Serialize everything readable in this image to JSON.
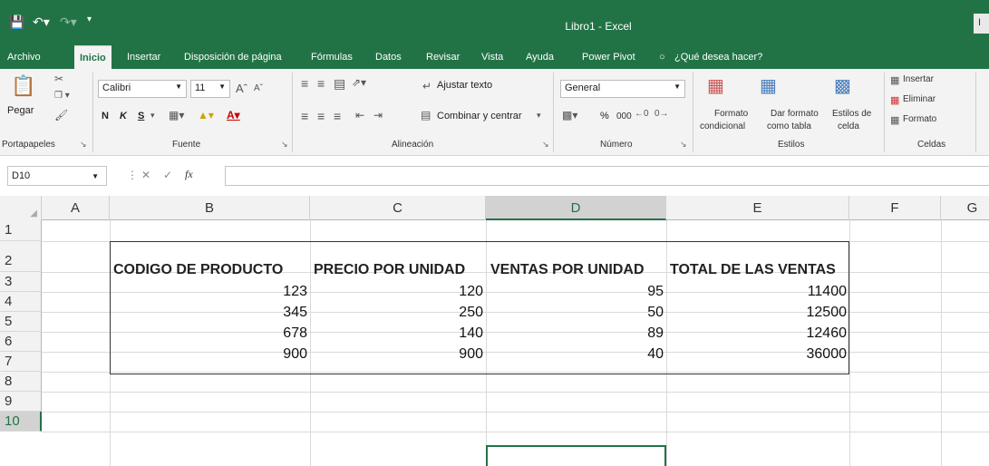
{
  "titlebar": {
    "title": "Libro1  -  Excel",
    "right_stub": "I"
  },
  "tabs": [
    "Archivo",
    "Inicio",
    "Insertar",
    "Disposición de página",
    "Fórmulas",
    "Datos",
    "Revisar",
    "Vista",
    "Ayuda",
    "Power Pivot",
    "¿Qué desea hacer?"
  ],
  "ribbon": {
    "clipboard": {
      "paste": "Pegar",
      "label": "Portapapeles"
    },
    "font": {
      "name": "Calibri",
      "size": "11",
      "bold": "N",
      "italic": "K",
      "underline": "S",
      "label": "Fuente"
    },
    "alignment": {
      "wrap": "Ajustar texto",
      "merge": "Combinar y centrar",
      "label": "Alineación"
    },
    "number": {
      "format": "General",
      "percent": "%",
      "thousands": "000",
      "label": "Número"
    },
    "styles": {
      "conditional_1": "Formato",
      "conditional_2": "condicional",
      "table_1": "Dar formato",
      "table_2": "como tabla",
      "cell_1": "Estilos de",
      "cell_2": "celda",
      "label": "Estilos"
    },
    "cells": {
      "insert": "Insertar",
      "delete": "Eliminar",
      "format": "Formato",
      "label": "Celdas"
    }
  },
  "formula_bar": {
    "name_box": "D10",
    "fx": "fx",
    "value": ""
  },
  "grid": {
    "columns": [
      "A",
      "B",
      "C",
      "D",
      "E",
      "F",
      "G"
    ],
    "rows": [
      "1",
      "2",
      "3",
      "4",
      "5",
      "6",
      "7",
      "8",
      "9",
      "10"
    ],
    "headers": [
      "CODIGO DE PRODUCTO",
      "PRECIO POR UNIDAD",
      "VENTAS POR UNIDAD",
      "TOTAL DE LAS VENTAS"
    ],
    "data": [
      [
        "123",
        "120",
        "95",
        "11400"
      ],
      [
        "345",
        "250",
        "50",
        "12500"
      ],
      [
        "678",
        "140",
        "89",
        "12460"
      ],
      [
        "900",
        "900",
        "40",
        "36000"
      ]
    ],
    "selected_cell": "D10"
  },
  "colors": {
    "accent": "#217346",
    "ribbon_bg": "#f3f3f3"
  }
}
